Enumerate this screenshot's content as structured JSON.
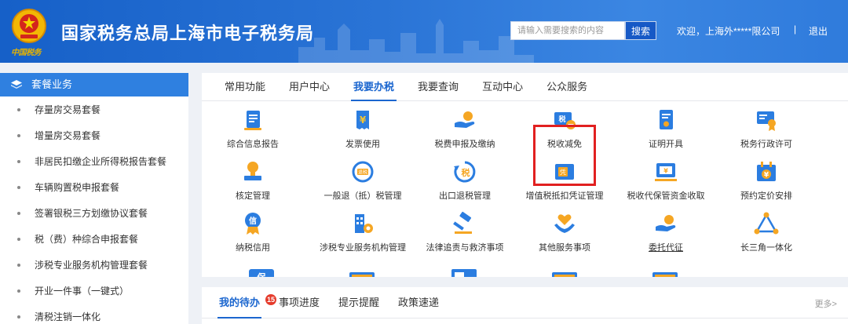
{
  "header": {
    "emblem_text": "中国税务",
    "title": "国家税务总局上海市电子税务局",
    "search": {
      "placeholder": "请输入需要搜索的内容",
      "button_label": "搜索"
    },
    "welcome": "欢迎，上海外*****限公司",
    "separator": "|",
    "logout": "退出"
  },
  "sidebar": {
    "header": "套餐业务",
    "items": [
      "存量房交易套餐",
      "增量房交易套餐",
      "非居民扣缴企业所得税报告套餐",
      "车辆购置税申报套餐",
      "签署银税三方划缴协议套餐",
      "税（费）种综合申报套餐",
      "涉税专业服务机构管理套餐",
      "开业一件事（一键式）",
      "清税注销一体化"
    ]
  },
  "main": {
    "tabs": [
      "常用功能",
      "用户中心",
      "我要办税",
      "我要查询",
      "互动中心",
      "公众服务"
    ],
    "active_tab": "我要办税",
    "items": [
      {
        "label": "综合信息报告",
        "icon": "document-report-icon"
      },
      {
        "label": "发票使用",
        "icon": "invoice-yuan-icon"
      },
      {
        "label": "税费申报及缴纳",
        "icon": "hand-coin-icon"
      },
      {
        "label": "税收减免",
        "icon": "tax-reduction-icon"
      },
      {
        "label": "证明开具",
        "icon": "certificate-icon"
      },
      {
        "label": "税务行政许可",
        "icon": "license-badge-icon"
      },
      {
        "label": "核定管理",
        "icon": "stamp-icon"
      },
      {
        "label": "一般退（抵）税管理",
        "icon": "refund-badge-icon"
      },
      {
        "label": "出口退税管理",
        "icon": "export-refund-icon"
      },
      {
        "label": "增值税抵扣凭证管理",
        "icon": "voucher-icon"
      },
      {
        "label": "税收代保管资金收取",
        "icon": "custody-fund-icon"
      },
      {
        "label": "预约定价安排",
        "icon": "calendar-yuan-icon"
      },
      {
        "label": "纳税信用",
        "icon": "credit-medal-icon"
      },
      {
        "label": "涉税专业服务机构管理",
        "icon": "building-gear-icon"
      },
      {
        "label": "法律追责与救济事项",
        "icon": "gavel-icon"
      },
      {
        "label": "其他服务事项",
        "icon": "heart-hands-icon"
      },
      {
        "label": "委托代征",
        "icon": "delegate-coin-icon"
      },
      {
        "label": "长三角一体化",
        "icon": "triangle-network-icon"
      }
    ],
    "highlighted_item": "税收减免",
    "highlight_color": "#e12020"
  },
  "bottom": {
    "tabs": [
      "我的待办",
      "事项进度",
      "提示提醒",
      "政策速递"
    ],
    "active_tab": "我的待办",
    "badge": "15",
    "more": "更多>"
  },
  "colors": {
    "accent": "#1b66cf",
    "header": "#2a74d6",
    "sidebar_active": "#2f80e0",
    "icon_orange": "#f5a623"
  }
}
